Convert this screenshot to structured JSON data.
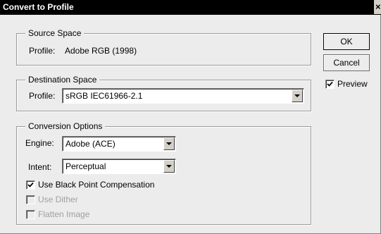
{
  "window": {
    "title": "Convert to Profile",
    "close_glyph": "×"
  },
  "source_space": {
    "legend": "Source Space",
    "profile_label": "Profile:",
    "profile_value": "Adobe RGB (1998)"
  },
  "destination_space": {
    "legend": "Destination Space",
    "profile_label": "Profile:",
    "profile_value": "sRGB IEC61966-2.1"
  },
  "conversion_options": {
    "legend": "Conversion Options",
    "engine_label": "Engine:",
    "engine_value": "Adobe (ACE)",
    "intent_label": "Intent:",
    "intent_value": "Perceptual",
    "black_point_label": "Use Black Point Compensation",
    "black_point_checked": true,
    "dither_label": "Use Dither",
    "dither_checked": false,
    "dither_enabled": false,
    "flatten_label": "Flatten Image",
    "flatten_checked": false,
    "flatten_enabled": false
  },
  "buttons": {
    "ok_label": "OK",
    "cancel_label": "Cancel"
  },
  "preview": {
    "label": "Preview",
    "checked": true
  },
  "icons": {
    "combo_arrow": "chevron-down-icon",
    "check": "checkmark-icon"
  }
}
